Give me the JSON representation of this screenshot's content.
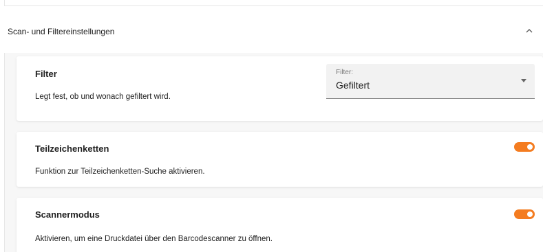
{
  "section": {
    "title": "Scan- und Filtereinstellungen",
    "expanded": true,
    "toggle_icon": "chevron-up-icon"
  },
  "colors": {
    "accent": "#f47c20",
    "card_bg": "#ffffff",
    "body_bg": "#f7f7f7"
  },
  "filter": {
    "title": "Filter",
    "description": "Legt fest, ob und wonach gefiltert wird.",
    "select_label": "Filter:",
    "select_value": "Gefiltert",
    "dropdown_icon": "caret-down-icon"
  },
  "substring": {
    "title": "Teilzeichenketten",
    "description": "Funktion zur Teilzeichenketten-Suche aktivieren.",
    "enabled": true
  },
  "scanner": {
    "title": "Scannermodus",
    "description": "Aktivieren, um eine Druckdatei über den Barcodescanner zu öffnen.",
    "enabled": true
  }
}
